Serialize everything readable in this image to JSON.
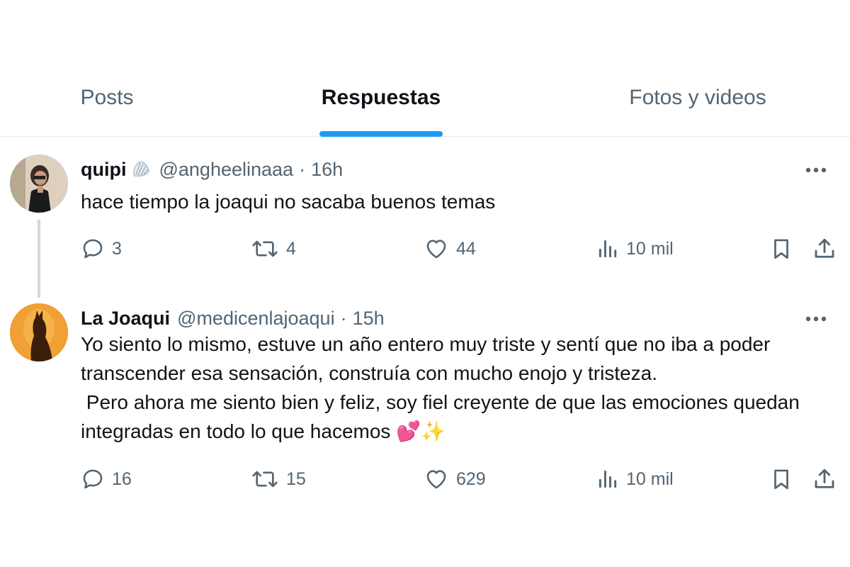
{
  "tabs": [
    {
      "label": "Posts",
      "active": false
    },
    {
      "label": "Respuestas",
      "active": true
    },
    {
      "label": "Fotos y videos",
      "active": false
    }
  ],
  "accent_color": "#1d9bf0",
  "tweets": [
    {
      "display_name": "quipi",
      "name_emoji": "shell-icon",
      "handle": "@angheelinaaa",
      "separator": "·",
      "time": "16h",
      "text": "hace tiempo la joaqui no sacaba buenos temas",
      "replies": "3",
      "retweets": "4",
      "likes": "44",
      "views": "10 mil"
    },
    {
      "display_name": "La Joaqui",
      "handle": "@medicenlajoaqui",
      "separator": "·",
      "time": "15h",
      "text": "Yo siento lo mismo, estuve un año entero muy triste y sentí que no iba a poder transcender esa sensación, construía con mucho enojo y tristeza.\n Pero ahora me siento bien y feliz, soy fiel creyente de que las emociones quedan integradas en todo lo que hacemos 💕✨",
      "replies": "16",
      "retweets": "15",
      "likes": "629",
      "views": "10 mil"
    }
  ]
}
